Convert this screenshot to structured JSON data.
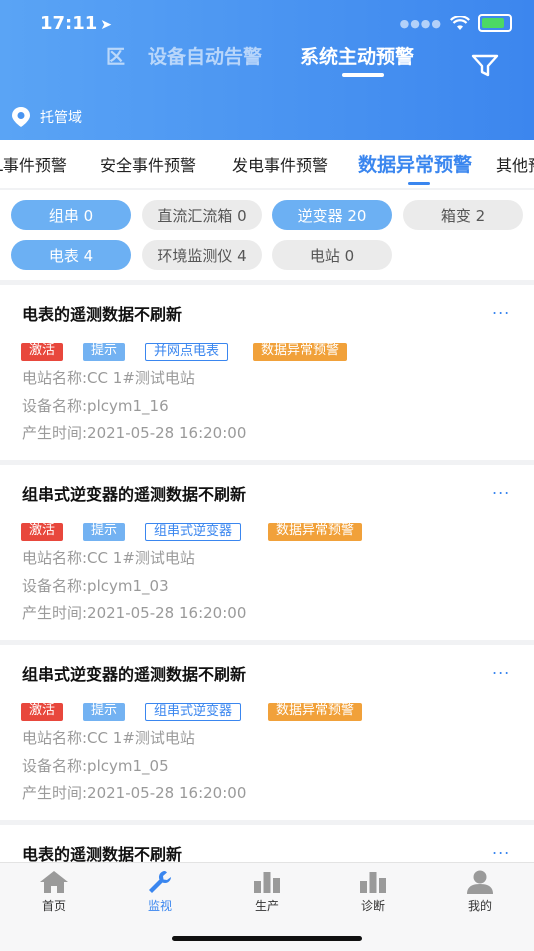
{
  "status_bar": {
    "time": "17:11",
    "location_arrow": "➤"
  },
  "top_tabs": [
    {
      "label": "区"
    },
    {
      "label": "设备自动告警"
    },
    {
      "label": "系统主动预警"
    }
  ],
  "location": {
    "label": "托管域"
  },
  "category_tabs": [
    {
      "label": "L事件预警"
    },
    {
      "label": "安全事件预警"
    },
    {
      "label": "发电事件预警"
    },
    {
      "label": "数据异常预警"
    },
    {
      "label": "其他预"
    }
  ],
  "filters": [
    {
      "label": "组串 0"
    },
    {
      "label": "直流汇流箱 0"
    },
    {
      "label": "逆变器 20"
    },
    {
      "label": "箱变 2"
    },
    {
      "label": "电表 4"
    },
    {
      "label": "环境监测仪 4"
    },
    {
      "label": "电站 0"
    }
  ],
  "alerts": [
    {
      "title": "电表的遥测数据不刷新",
      "more": "...",
      "tags": [
        "激活",
        "提示",
        "并网点电表",
        "数据异常预警"
      ],
      "station": "电站名称:CC 1#测试电站",
      "device": "设备名称:plcym1_16",
      "time": "产生时间:2021-05-28 16:20:00"
    },
    {
      "title": "组串式逆变器的遥测数据不刷新",
      "more": "...",
      "tags": [
        "激活",
        "提示",
        "组串式逆变器",
        "数据异常预警"
      ],
      "station": "电站名称:CC 1#测试电站",
      "device": "设备名称:plcym1_03",
      "time": "产生时间:2021-05-28 16:20:00"
    },
    {
      "title": "组串式逆变器的遥测数据不刷新",
      "more": "...",
      "tags": [
        "激活",
        "提示",
        "组串式逆变器",
        "数据异常预警"
      ],
      "station": "电站名称:CC 1#测试电站",
      "device": "设备名称:plcym1_05",
      "time": "产生时间:2021-05-28 16:20:00"
    },
    {
      "title": "电表的遥测数据不刷新",
      "more": "..."
    }
  ],
  "bottom_tabs": [
    {
      "label": "首页",
      "icon": "home-icon"
    },
    {
      "label": "监视",
      "icon": "wrench-icon"
    },
    {
      "label": "生产",
      "icon": "bar-chart-icon"
    },
    {
      "label": "诊断",
      "icon": "bar-chart-icon"
    },
    {
      "label": "我的",
      "icon": "user-icon"
    }
  ],
  "colors": {
    "accent": "#3a86ef",
    "header": "#4a95f1",
    "tag_red": "#e8473c",
    "tag_orange": "#f1a13a"
  }
}
